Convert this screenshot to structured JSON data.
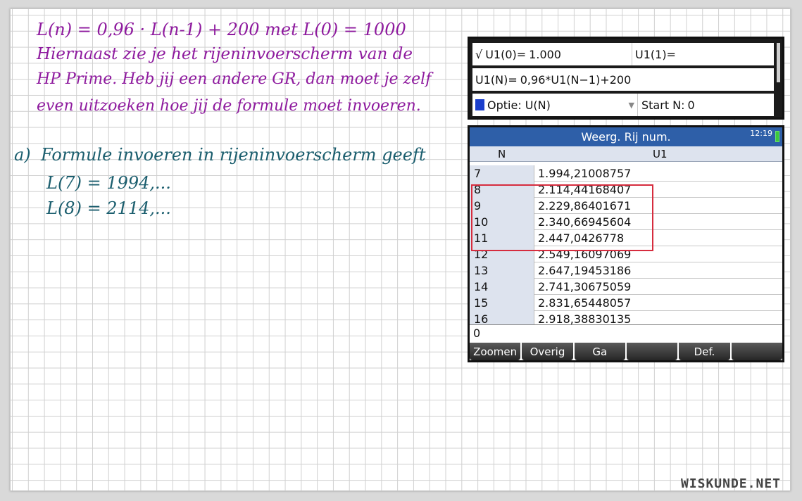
{
  "notes": {
    "line1": "L(n) = 0,96 · L(n-1) + 200  met  L(0) = 1000",
    "line2": "Hiernaast zie je het rijeninvoerscherm van de",
    "line3": "HP Prime. Heb jij een andere GR, dan moet je zelf",
    "line4": "even uitzoeken hoe jij de formule moet invoeren.",
    "a_label": "a)",
    "a_text": "Formule invoeren in rijeninvoerscherm geeft",
    "l7": "L(7) = 1994,...",
    "l8": "L(8) = 2114,..."
  },
  "calc_top": {
    "check_mark": "√",
    "u0_label": "U1(0)=",
    "u0_value": "1.000",
    "u1_label": "U1(1)=",
    "u1_value": "",
    "formula_label": "U1(N)=",
    "formula_value": "0,96*U1(N−1)+200",
    "option_label": "Optie:",
    "option_value": "U(N)",
    "start_label": "Start N:",
    "start_value": "0"
  },
  "calc_table": {
    "title": "Weerg. Rij num.",
    "time": "12:19",
    "col_n": "N",
    "col_u1": "U1",
    "rows": [
      {
        "n": "7",
        "v": "1.994,21008757"
      },
      {
        "n": "8",
        "v": "2.114,44168407"
      },
      {
        "n": "9",
        "v": "2.229,86401671"
      },
      {
        "n": "10",
        "v": "2.340,66945604"
      },
      {
        "n": "11",
        "v": "2.447,0426778"
      },
      {
        "n": "12",
        "v": "2.549,16097069"
      },
      {
        "n": "13",
        "v": "2.647,19453186"
      },
      {
        "n": "14",
        "v": "2.741,30675059"
      },
      {
        "n": "15",
        "v": "2.831,65448057"
      },
      {
        "n": "16",
        "v": "2.918,38830135"
      }
    ],
    "command_value": "0",
    "menu": [
      "Zoomen",
      "Overig",
      "Ga",
      "",
      "Def.",
      ""
    ]
  },
  "brand": "WISKUNDE.NET",
  "colors": {
    "purple_ink": "#8e1a9e",
    "teal_ink": "#1b5e6e",
    "title_bar": "#2e5fa8",
    "highlight": "#d62c3e"
  }
}
